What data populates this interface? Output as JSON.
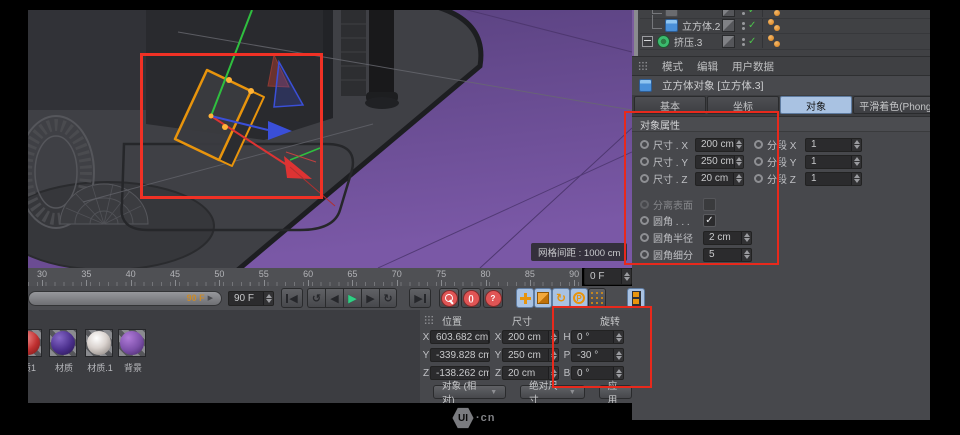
{
  "viewport": {
    "grid_spacing_label": "网格间距 : 1000 cm"
  },
  "object_manager": {
    "rows": [
      {
        "label": "立方体.2"
      },
      {
        "label": "挤压.3"
      }
    ]
  },
  "attribute_manager": {
    "menu": {
      "mode": "模式",
      "edit": "编辑",
      "user_data": "用户数据"
    },
    "title": "立方体对象 [立方体.3]",
    "tabs": {
      "basic": "基本",
      "coordinates": "坐标",
      "object": "对象",
      "phong": "平滑着色(Phong)"
    },
    "section": "对象属性",
    "fields": {
      "size_x": {
        "label": "尺寸 . X",
        "value": "200 cm"
      },
      "seg_x": {
        "label": "分段 X",
        "value": "1"
      },
      "size_y": {
        "label": "尺寸 . Y",
        "value": "250 cm"
      },
      "seg_y": {
        "label": "分段 Y",
        "value": "1"
      },
      "size_z": {
        "label": "尺寸 . Z",
        "value": "20 cm"
      },
      "seg_z": {
        "label": "分段 Z",
        "value": "1"
      },
      "separate_surfaces": {
        "label": "分离表面",
        "checked": false
      },
      "fillet": {
        "label": "圆角 . . .",
        "checked": true
      },
      "fillet_radius": {
        "label": "圆角半径",
        "value": "2 cm"
      },
      "fillet_subdiv": {
        "label": "圆角细分",
        "value": "5"
      }
    }
  },
  "timeline": {
    "ticks": [
      30,
      35,
      40,
      45,
      50,
      55,
      60,
      65,
      70,
      75,
      80,
      85,
      90
    ],
    "end_frame_field": "0 F",
    "range_end_label": "90 F",
    "current_frame_field": "90 F"
  },
  "transport": {
    "icons": {
      "goto_start": "◀",
      "play_backward": "↺",
      "prev_frame": "◀",
      "play": "▶",
      "next_frame": "▶",
      "play_forward": "↻",
      "goto_end": "▶",
      "auto_key": "()",
      "help": "?",
      "record_rotation": "↻",
      "record_parameter": "P"
    }
  },
  "coordinates": {
    "headers": {
      "position": "位置",
      "size": "尺寸",
      "rotation": "旋转"
    },
    "position": [
      {
        "axis": "X",
        "value": "603.682 cm"
      },
      {
        "axis": "Y",
        "value": "-339.828 cm"
      },
      {
        "axis": "Z",
        "value": "-138.262 cm"
      }
    ],
    "size": [
      {
        "axis": "X",
        "value": "200 cm"
      },
      {
        "axis": "Y",
        "value": "250 cm"
      },
      {
        "axis": "Z",
        "value": "20 cm"
      }
    ],
    "rotation": [
      {
        "axis": "H",
        "value": "0 °"
      },
      {
        "axis": "P",
        "value": "-30 °"
      },
      {
        "axis": "B",
        "value": "0 °"
      }
    ],
    "buttons": {
      "mode": "对象 (相对)",
      "size_mode": "绝对尺寸",
      "apply": "应用"
    }
  },
  "materials": {
    "items": [
      {
        "label": "质1",
        "color": "#C23B3B"
      },
      {
        "label": "材质",
        "color": "#4A2F8C"
      },
      {
        "label": "材质.1",
        "color": "#D8D2CE"
      },
      {
        "label": "背景",
        "color": "#7B4FA8"
      }
    ]
  },
  "icons": {
    "check": "✓",
    "dropdown": "▼",
    "slider_arrow": "▶"
  },
  "footer": {
    "logo_text": "UI",
    "logo_suffix": "·cn"
  },
  "colors": {
    "accent_orange": "#E8940C",
    "annotation_red": "#E8291C",
    "floor_purple": "#6E4E97",
    "play_green": "#3ED788",
    "selected_tab_blue": "#A9C2E2"
  }
}
